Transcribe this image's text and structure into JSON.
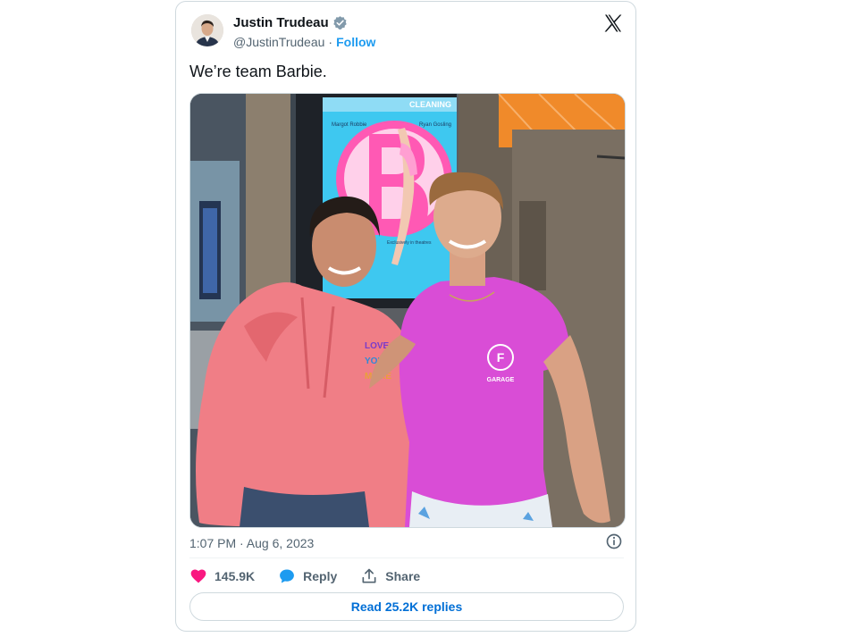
{
  "author": {
    "name": "Justin Trudeau",
    "handle": "@JustinTrudeau",
    "follow_label": "Follow",
    "separator": "·"
  },
  "tweet": {
    "text": "We’re team Barbie.",
    "timestamp": "1:07 PM · Aug 6, 2023"
  },
  "actions": {
    "like_count": "145.9K",
    "reply_label": "Reply",
    "share_label": "Share"
  },
  "read_replies_label": "Read 25.2K replies",
  "icons": {
    "verified": "verified-badge-icon",
    "logo": "x-logo-icon",
    "info": "info-icon",
    "like": "heart-icon",
    "reply": "speech-bubble-icon",
    "share": "share-arrow-icon"
  },
  "colors": {
    "like": "#f91880",
    "reply": "#1d9bf0",
    "link": "#006fd6",
    "follow": "#1d9bf0",
    "verified": "#829aab"
  },
  "photo": {
    "poster_text": {
      "top": "CLEANING",
      "actor_left": "Margot Robbie",
      "actor_right": "Ryan Gosling",
      "release": "Exclusively in theatres"
    },
    "shirt_logo_letter": "F",
    "shirt_text": "GARAGE",
    "hoodie_text": [
      "LOVE",
      "YOU",
      "MORE"
    ]
  }
}
